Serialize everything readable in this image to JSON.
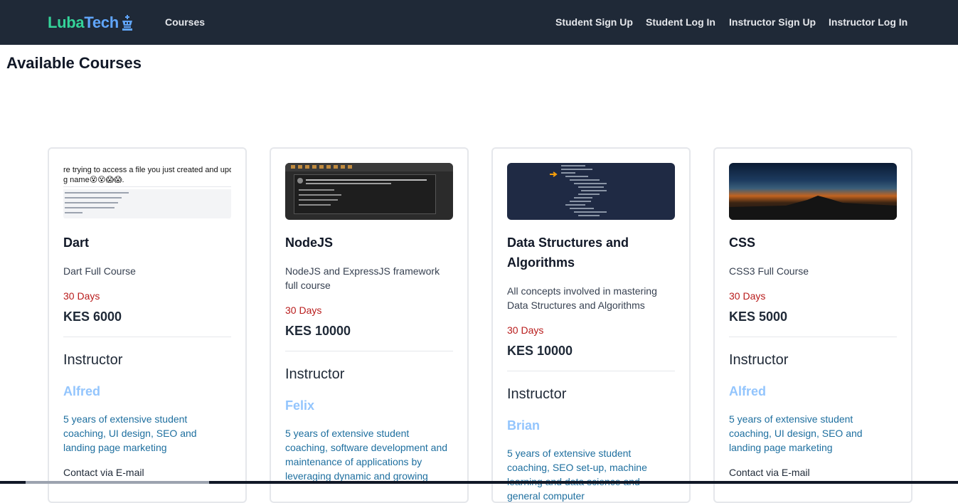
{
  "navbar": {
    "brand_part1": "Luba",
    "brand_part2": "Tech",
    "brand_icon": "chess-king-icon",
    "links": {
      "courses": "Courses",
      "student_signup": "Student Sign Up",
      "student_login": "Student Log In",
      "instructor_signup": "Instructor Sign Up",
      "instructor_login": "Instructor Log In"
    }
  },
  "page": {
    "title": "Available Courses"
  },
  "courses": [
    {
      "title": "Dart",
      "description": "Dart Full Course",
      "duration": "30 Days",
      "price": "KES 6000",
      "instructor_heading": "Instructor",
      "instructor_name": "Alfred",
      "bio": "5 years of extensive student coaching, UI design, SEO and landing page marketing",
      "contact": "Contact via E-mail",
      "thumb_line1": "re trying to access a file you just created and upda",
      "thumb_line2": "g name😵😵😱😱."
    },
    {
      "title": "NodeJS",
      "description": "NodeJS and ExpressJS framework full course",
      "duration": "30 Days",
      "price": "KES 10000",
      "instructor_heading": "Instructor",
      "instructor_name": "Felix",
      "bio": "5 years of extensive student coaching, software development and maintenance of applications by leveraging dynamic and growing"
    },
    {
      "title": "Data Structures and Algorithms",
      "description": "All concepts involved in mastering Data Structures and Algorithms",
      "duration": "30 Days",
      "price": "KES 10000",
      "instructor_heading": "Instructor",
      "instructor_name": "Brian",
      "bio": "5 years of extensive student coaching, SEO set-up, machine learning and data science and general computer"
    },
    {
      "title": "CSS",
      "description": "CSS3 Full Course",
      "duration": "30 Days",
      "price": "KES 5000",
      "instructor_heading": "Instructor",
      "instructor_name": "Alfred",
      "bio": "5 years of extensive student coaching, UI design, SEO and landing page marketing",
      "contact": "Contact via E-mail"
    }
  ],
  "colors": {
    "navbar_bg": "#1f2937",
    "brand_green": "#34d399",
    "brand_blue": "#60a5fa",
    "duration_red": "#b91c1c",
    "instructor_name": "#93c5fd"
  }
}
